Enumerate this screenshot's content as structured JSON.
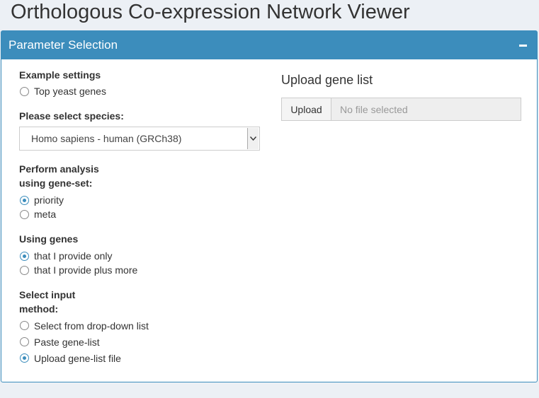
{
  "app": {
    "title": "Orthologous Co-expression Network Viewer"
  },
  "panel": {
    "title": "Parameter Selection",
    "collapse_icon": "minus-icon"
  },
  "example": {
    "label": "Example settings",
    "options": [
      {
        "label": "Top yeast genes",
        "checked": false
      }
    ]
  },
  "species": {
    "label": "Please select species:",
    "selected": "Homo sapiens - human (GRCh38)"
  },
  "analysis": {
    "label_line1": "Perform analysis",
    "label_line2": "using gene-set:",
    "options": [
      {
        "label": "priority",
        "checked": true
      },
      {
        "label": "meta",
        "checked": false
      }
    ]
  },
  "genes": {
    "label": "Using genes",
    "options": [
      {
        "label": "that I provide only",
        "checked": true
      },
      {
        "label": "that I provide plus more",
        "checked": false
      }
    ]
  },
  "input_method": {
    "label_line1": "Select input",
    "label_line2": "method:",
    "options": [
      {
        "label": "Select from drop-down list",
        "checked": false
      },
      {
        "label": "Paste gene-list",
        "checked": false
      },
      {
        "label": "Upload gene-list file",
        "checked": true
      }
    ]
  },
  "upload": {
    "title": "Upload gene list",
    "button_label": "Upload",
    "status": "No file selected"
  }
}
